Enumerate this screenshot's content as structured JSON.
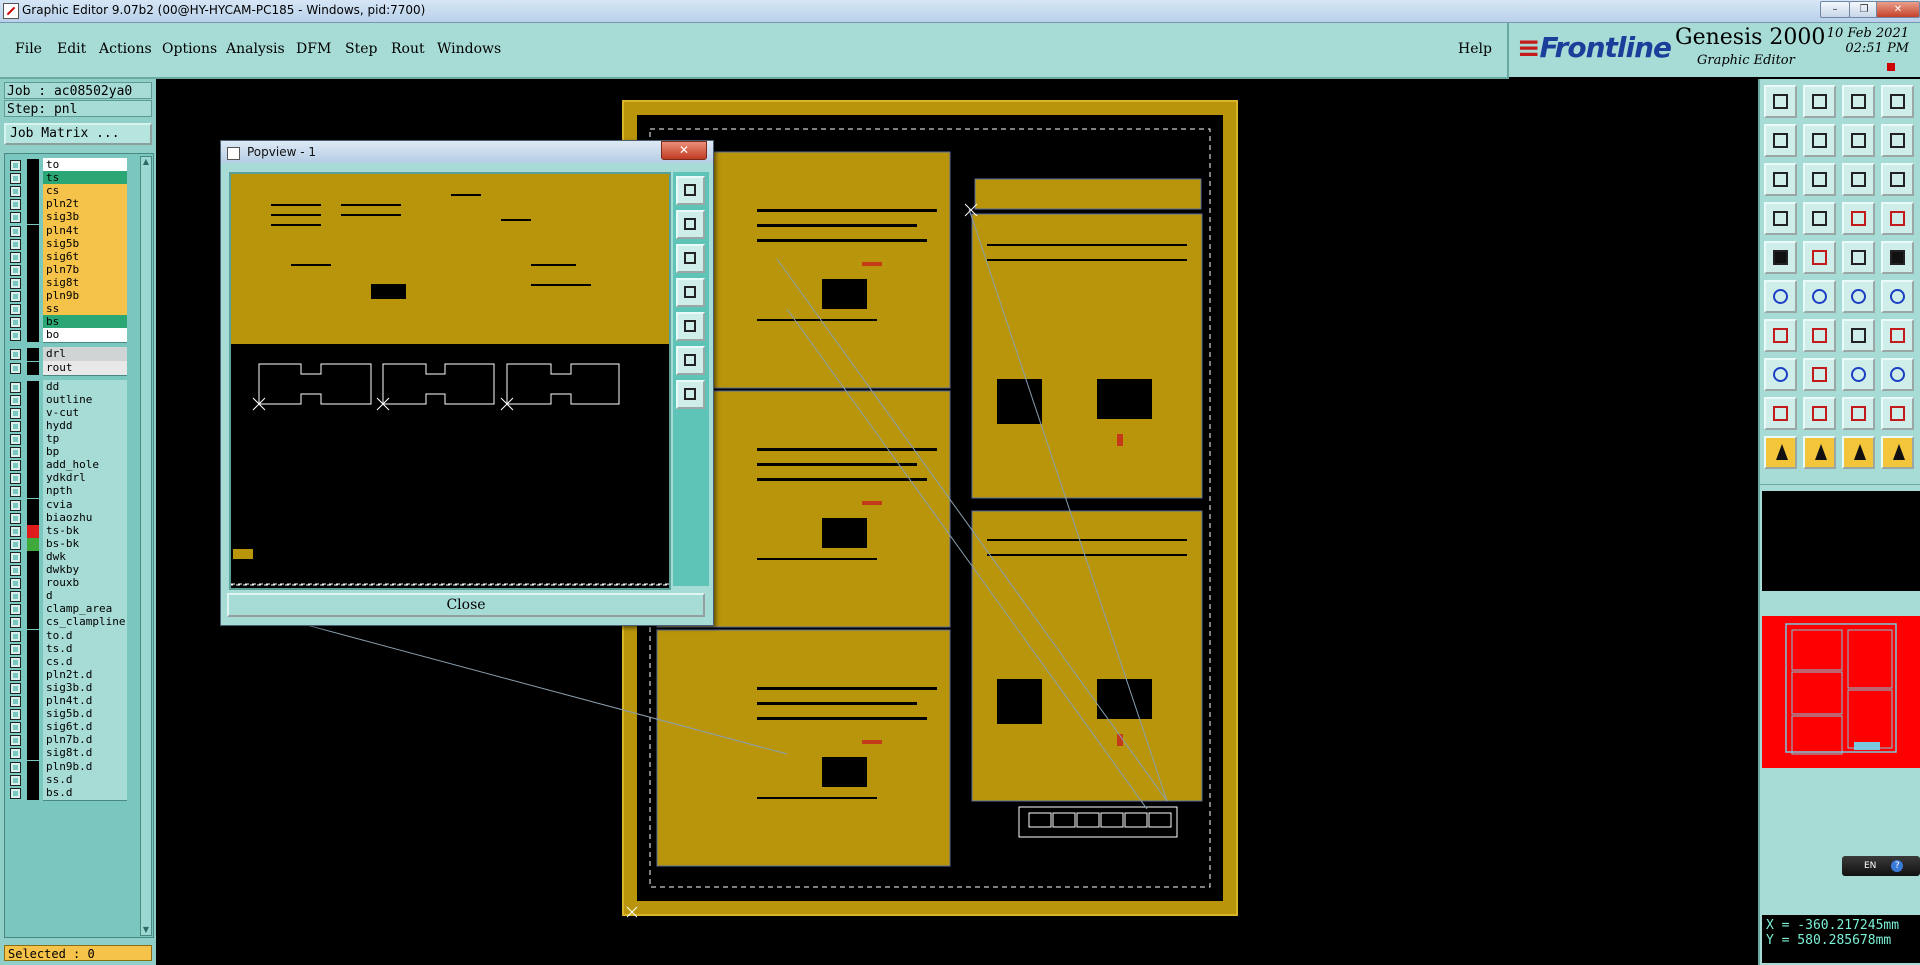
{
  "window": {
    "title": "Graphic Editor 9.07b2 (00@HY-HYCAM-PC185 - Windows, pid:7700)",
    "controls": [
      "–",
      "❐",
      "✕"
    ]
  },
  "menubar": {
    "items": [
      "File",
      "Edit",
      "Actions",
      "Options",
      "Analysis",
      "DFM",
      "Step",
      "Rout",
      "Windows"
    ],
    "help": "Help"
  },
  "brand": {
    "logo": "Frontline",
    "product": "Genesis 2000",
    "subtitle": "Graphic Editor",
    "date": "10 Feb 2021",
    "time": "02:51 PM"
  },
  "job": {
    "job_line": "Job : ac08502ya0",
    "step_line": "Step: pnl",
    "matrix_button": "Job Matrix ..."
  },
  "layers": [
    {
      "name": "to",
      "color": "#ffffff",
      "swatch": "#000000"
    },
    {
      "name": "ts",
      "color": "#2aa774",
      "swatch": "#000000"
    },
    {
      "name": "cs",
      "color": "#f5c24a",
      "swatch": "#000000"
    },
    {
      "name": "pln2t",
      "color": "#f5c24a",
      "swatch": "#000000"
    },
    {
      "name": "sig3b",
      "color": "#f5c24a",
      "swatch": "#000000"
    },
    {
      "name": "pln4t",
      "color": "#f5c24a",
      "swatch": "#000000"
    },
    {
      "name": "sig5b",
      "color": "#f5c24a",
      "swatch": "#000000"
    },
    {
      "name": "sig6t",
      "color": "#f5c24a",
      "swatch": "#000000"
    },
    {
      "name": "pln7b",
      "color": "#f5c24a",
      "swatch": "#000000"
    },
    {
      "name": "sig8t",
      "color": "#f5c24a",
      "swatch": "#000000"
    },
    {
      "name": "pln9b",
      "color": "#f5c24a",
      "swatch": "#000000"
    },
    {
      "name": "ss",
      "color": "#f5c24a",
      "swatch": "#000000"
    },
    {
      "name": "bs",
      "color": "#2aa774",
      "swatch": "#000000"
    },
    {
      "name": "bo",
      "color": "#ffffff",
      "swatch": "#000000"
    },
    {
      "name": "drl",
      "color": "#cfd4d4",
      "swatch": "#000000"
    },
    {
      "name": "rout",
      "color": "#e8e8e8",
      "swatch": "#000000"
    },
    {
      "name": "dd",
      "color": "#a7dcd6",
      "swatch": "#000000"
    },
    {
      "name": "outline",
      "color": "#a7dcd6",
      "swatch": "#000000"
    },
    {
      "name": "v-cut",
      "color": "#a7dcd6",
      "swatch": "#000000"
    },
    {
      "name": "hydd",
      "color": "#a7dcd6",
      "swatch": "#000000"
    },
    {
      "name": "tp",
      "color": "#a7dcd6",
      "swatch": "#000000"
    },
    {
      "name": "bp",
      "color": "#a7dcd6",
      "swatch": "#000000"
    },
    {
      "name": "add_hole",
      "color": "#a7dcd6",
      "swatch": "#000000"
    },
    {
      "name": "ydkdrl",
      "color": "#a7dcd6",
      "swatch": "#000000"
    },
    {
      "name": "npth",
      "color": "#a7dcd6",
      "swatch": "#000000"
    },
    {
      "name": "cvia",
      "color": "#a7dcd6",
      "swatch": "#000000"
    },
    {
      "name": "biaozhu",
      "color": "#a7dcd6",
      "swatch": "#000000"
    },
    {
      "name": "ts-bk",
      "color": "#a7dcd6",
      "swatch": "#e01b1b"
    },
    {
      "name": "bs-bk",
      "color": "#a7dcd6",
      "swatch": "#3fa93b"
    },
    {
      "name": "dwk",
      "color": "#a7dcd6",
      "swatch": "#000000"
    },
    {
      "name": "dwkby",
      "color": "#a7dcd6",
      "swatch": "#000000"
    },
    {
      "name": "rouxb",
      "color": "#a7dcd6",
      "swatch": "#000000"
    },
    {
      "name": "d",
      "color": "#a7dcd6",
      "swatch": "#000000"
    },
    {
      "name": "clamp_area",
      "color": "#a7dcd6",
      "swatch": "#000000"
    },
    {
      "name": "cs_clampline",
      "color": "#a7dcd6",
      "swatch": "#000000"
    },
    {
      "name": "to.d",
      "color": "#a7dcd6",
      "swatch": "#000000"
    },
    {
      "name": "ts.d",
      "color": "#a7dcd6",
      "swatch": "#000000"
    },
    {
      "name": "cs.d",
      "color": "#a7dcd6",
      "swatch": "#000000"
    },
    {
      "name": "pln2t.d",
      "color": "#a7dcd6",
      "swatch": "#000000"
    },
    {
      "name": "sig3b.d",
      "color": "#a7dcd6",
      "swatch": "#000000"
    },
    {
      "name": "pln4t.d",
      "color": "#a7dcd6",
      "swatch": "#000000"
    },
    {
      "name": "sig5b.d",
      "color": "#a7dcd6",
      "swatch": "#000000"
    },
    {
      "name": "sig6t.d",
      "color": "#a7dcd6",
      "swatch": "#000000"
    },
    {
      "name": "pln7b.d",
      "color": "#a7dcd6",
      "swatch": "#000000"
    },
    {
      "name": "sig8t.d",
      "color": "#a7dcd6",
      "swatch": "#000000"
    },
    {
      "name": "pln9b.d",
      "color": "#a7dcd6",
      "swatch": "#000000"
    },
    {
      "name": "ss.d",
      "color": "#a7dcd6",
      "swatch": "#000000"
    },
    {
      "name": "bs.d",
      "color": "#a7dcd6",
      "swatch": "#000000"
    }
  ],
  "status": {
    "selected": "Selected : 0"
  },
  "popview": {
    "title": "Popview - 1",
    "close_label": "Close"
  },
  "coords": {
    "x": "X = -360.217245mm",
    "y": "Y =  580.285678mm"
  },
  "language": {
    "label": "EN"
  },
  "colors": {
    "board": "#b8950a",
    "panel_bg": "#a7dcd6",
    "accent": "#f5c24a"
  }
}
